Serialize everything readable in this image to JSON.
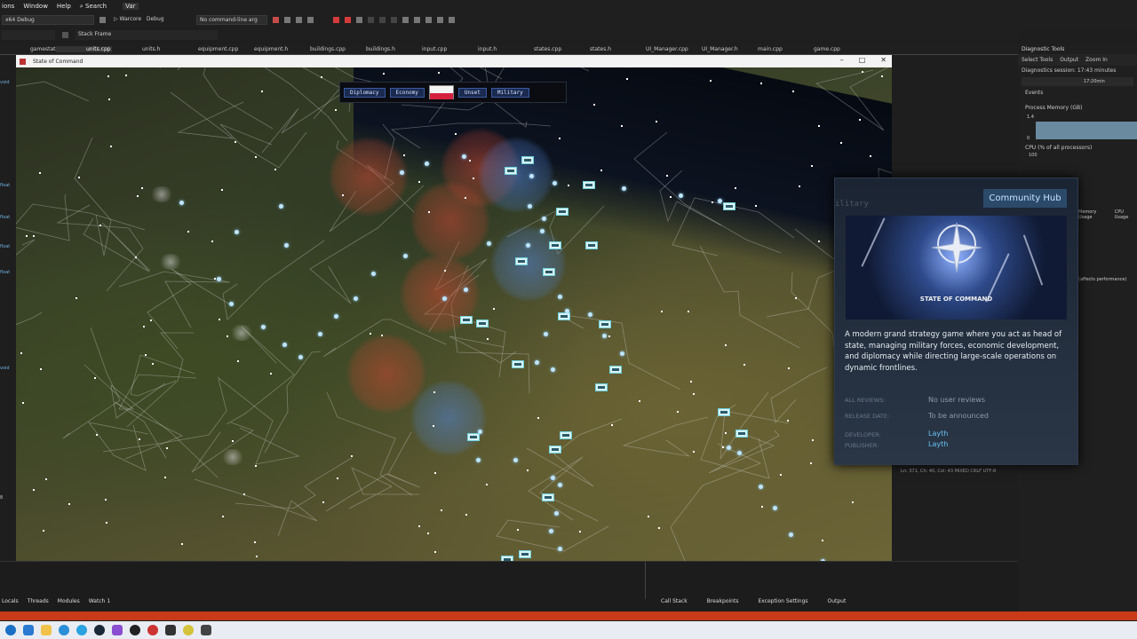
{
  "vs": {
    "menu": [
      "ions",
      "Window",
      "Help",
      "Search",
      "Var"
    ],
    "toolbar": {
      "platform": "x64 Debug",
      "project": "Warcore",
      "config": "Debug",
      "cmdline": "No command-line arg",
      "stackframe": "Stack Frame"
    },
    "tabs": [
      "gamestate.h",
      "units.cpp",
      "units.h",
      "equipment.cpp",
      "equipment.h",
      "buildings.cpp",
      "buildings.h",
      "input.cpp",
      "input.h",
      "states.cpp",
      "states.h",
      "UI_Manager.cpp",
      "UI_Manager.h",
      "main.cpp",
      "game.cpp"
    ],
    "active_tab_index": 1,
    "diagnostics": {
      "title": "Diagnostic Tools",
      "select_tools": "Select Tools",
      "output": "Output",
      "zoom": "Zoom In",
      "session": "Diagnostics session: 17:43 minutes",
      "time_marker": "17:20min",
      "events": "Events",
      "process_memory": "Process Memory (GB)",
      "mem_max": "1.4",
      "mem_min": "0",
      "cpu": "CPU (% of all processors)",
      "cpu_max": "100",
      "memory_usage": "Memory Usage",
      "cpu_usage": "CPU Usage",
      "affects_perf": "(affects performance)"
    },
    "code_status": "Ln: 371, Ch: 40, Col: 43   MIXED   CRLF   UTF-8",
    "gutter_labels": [
      "void",
      "float",
      "float",
      "float",
      "float",
      "void",
      "",
      "8"
    ],
    "bottom_tabs_left": [
      "Locals",
      "Threads",
      "Modules",
      "Watch 1"
    ],
    "bottom_tabs_right": [
      "Call Stack",
      "Breakpoints",
      "Exception Settings",
      "Output"
    ]
  },
  "game": {
    "window_title": "State of Command",
    "top_menu": {
      "diplomacy": "Diplomacy",
      "economy": "Economy",
      "unset": "Unset",
      "military": "Military"
    },
    "flag_colors": [
      "#f4f4f4",
      "#d4213d"
    ]
  },
  "store_popup": {
    "hub_button": "Community Hub",
    "ghost_tab": "ilitary",
    "capsule_logo": "STATE OF COMMAND",
    "description": "A modern grand strategy game where you act as head of state, managing military forces, economic development, and diplomacy while directing large-scale operations on dynamic frontlines.",
    "reviews_label": "ALL REVIEWS:",
    "reviews_value": "No user reviews",
    "release_label": "RELEASE DATE:",
    "release_value": "To be announced",
    "developer_label": "DEVELOPER:",
    "developer_value": "Layth",
    "publisher_label": "PUBLISHER:",
    "publisher_value": "Layth"
  },
  "colors": {
    "accent_blue": "#66c0f4",
    "vs_status": "#c83a18",
    "hostile_zone": "#c84632",
    "friendly_zone": "#5082d2",
    "unit": "#d8f2f4"
  },
  "icons": [
    "search-icon",
    "play-icon",
    "stop-icon",
    "restart-icon",
    "minimize-icon",
    "maximize-icon",
    "close-icon",
    "unit-icon",
    "supply-node-icon",
    "windows-start-icon"
  ]
}
